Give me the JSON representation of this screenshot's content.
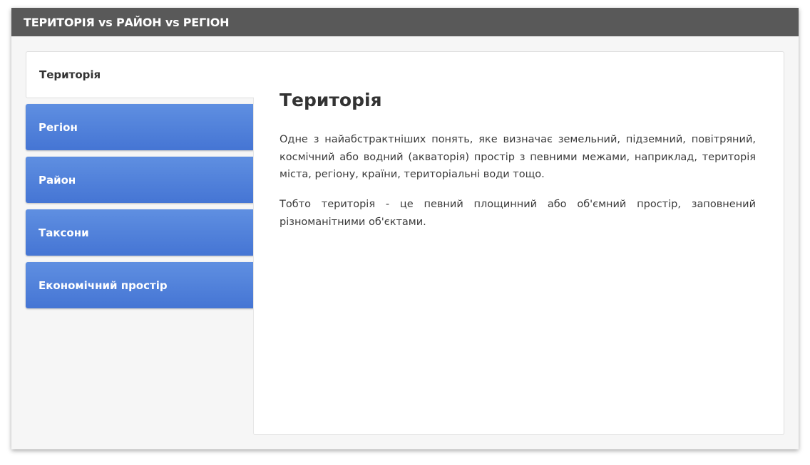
{
  "header": {
    "title": "ТЕРИТОРІЯ vs РАЙОН vs РЕГІОН"
  },
  "tabs": [
    {
      "label": "Територія",
      "active": true
    },
    {
      "label": "Регіон",
      "active": false
    },
    {
      "label": "Район",
      "active": false
    },
    {
      "label": "Таксони",
      "active": false
    },
    {
      "label": "Економічний простір",
      "active": false
    }
  ],
  "content": {
    "title": "Територія",
    "paragraphs": [
      "Одне з найабстрактніших понять, яке визначає земельний, підземний, повітряний, космічний або водний (акваторія) простір з певними межами, наприклад, територія міста, регіону, країни, територіальні води тощо.",
      "Тобто територія - це певний площинний або об'ємний простір, заповнений різноманітними об'єктами."
    ]
  },
  "colors": {
    "header_bg": "#595959",
    "tab_blue_top": "#5f8fe1",
    "tab_blue_bottom": "#4575d4",
    "card_bg": "#f6f6f6"
  }
}
